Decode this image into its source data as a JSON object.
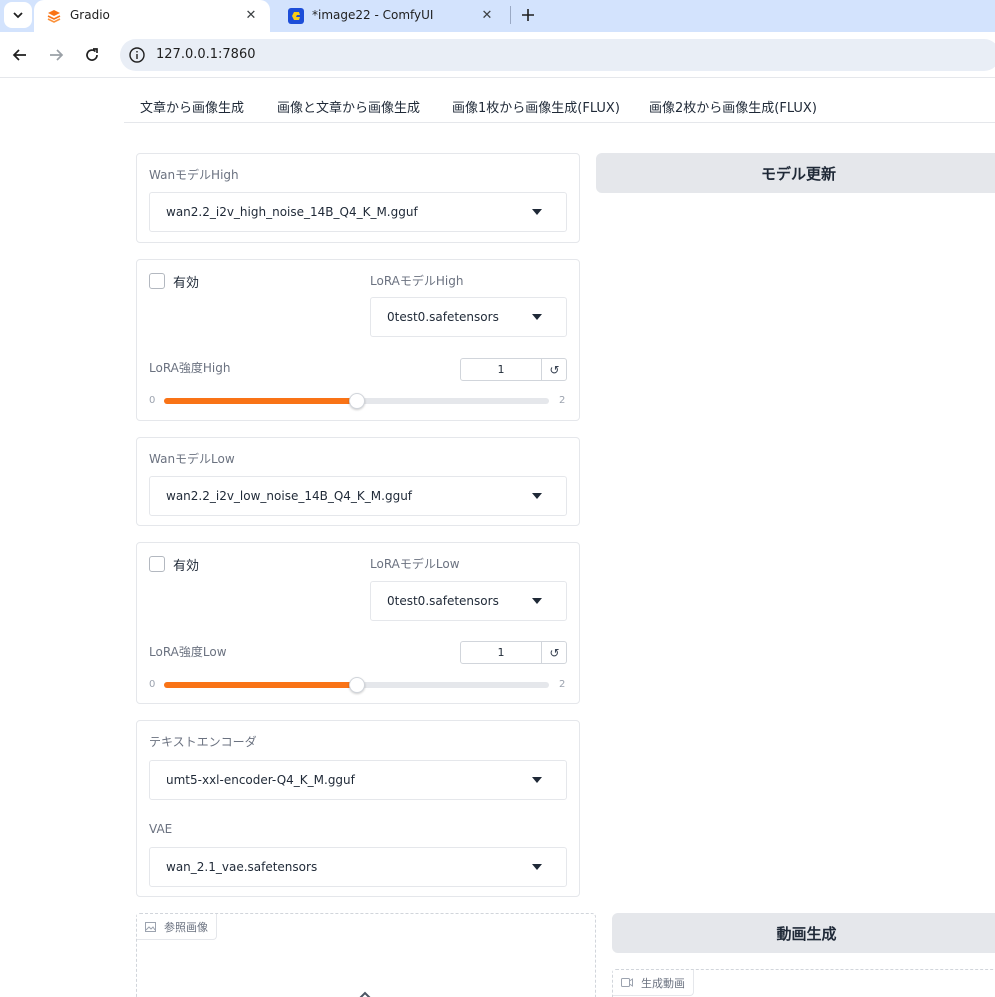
{
  "browser": {
    "tabs": [
      {
        "title": "Gradio",
        "active": true
      },
      {
        "title": "*image22 - ComfyUI",
        "active": false
      }
    ],
    "url": "127.0.0.1:7860"
  },
  "app_tabs": [
    "文章から画像生成",
    "画像と文章から画像生成",
    "画像1枚から画像生成(FLUX)",
    "画像2枚から画像生成(FLUX)"
  ],
  "wan_high": {
    "label": "WanモデルHigh",
    "value": "wan2.2_i2v_high_noise_14B_Q4_K_M.gguf"
  },
  "lora_high": {
    "enable_label": "有効",
    "model_label": "LoRAモデルHigh",
    "model_value": "0test0.safetensors",
    "strength_label": "LoRA強度High",
    "strength_value": "1",
    "min": "0",
    "max": "2",
    "fraction": 0.5
  },
  "wan_low": {
    "label": "WanモデルLow",
    "value": "wan2.2_i2v_low_noise_14B_Q4_K_M.gguf"
  },
  "lora_low": {
    "enable_label": "有効",
    "model_label": "LoRAモデルLow",
    "model_value": "0test0.safetensors",
    "strength_label": "LoRA強度Low",
    "strength_value": "1",
    "min": "0",
    "max": "2",
    "fraction": 0.5
  },
  "text_encoder": {
    "label": "テキストエンコーダ",
    "value": "umt5-xxl-encoder-Q4_K_M.gguf"
  },
  "vae": {
    "label": "VAE",
    "value": "wan_2.1_vae.safetensors"
  },
  "buttons": {
    "update_model": "モデル更新",
    "generate_video": "動画生成"
  },
  "reference_image": {
    "label": "参照画像"
  },
  "output_video": {
    "label": "生成動画"
  },
  "colors": {
    "accent": "#f97316",
    "button_bg": "#e5e7eb"
  }
}
